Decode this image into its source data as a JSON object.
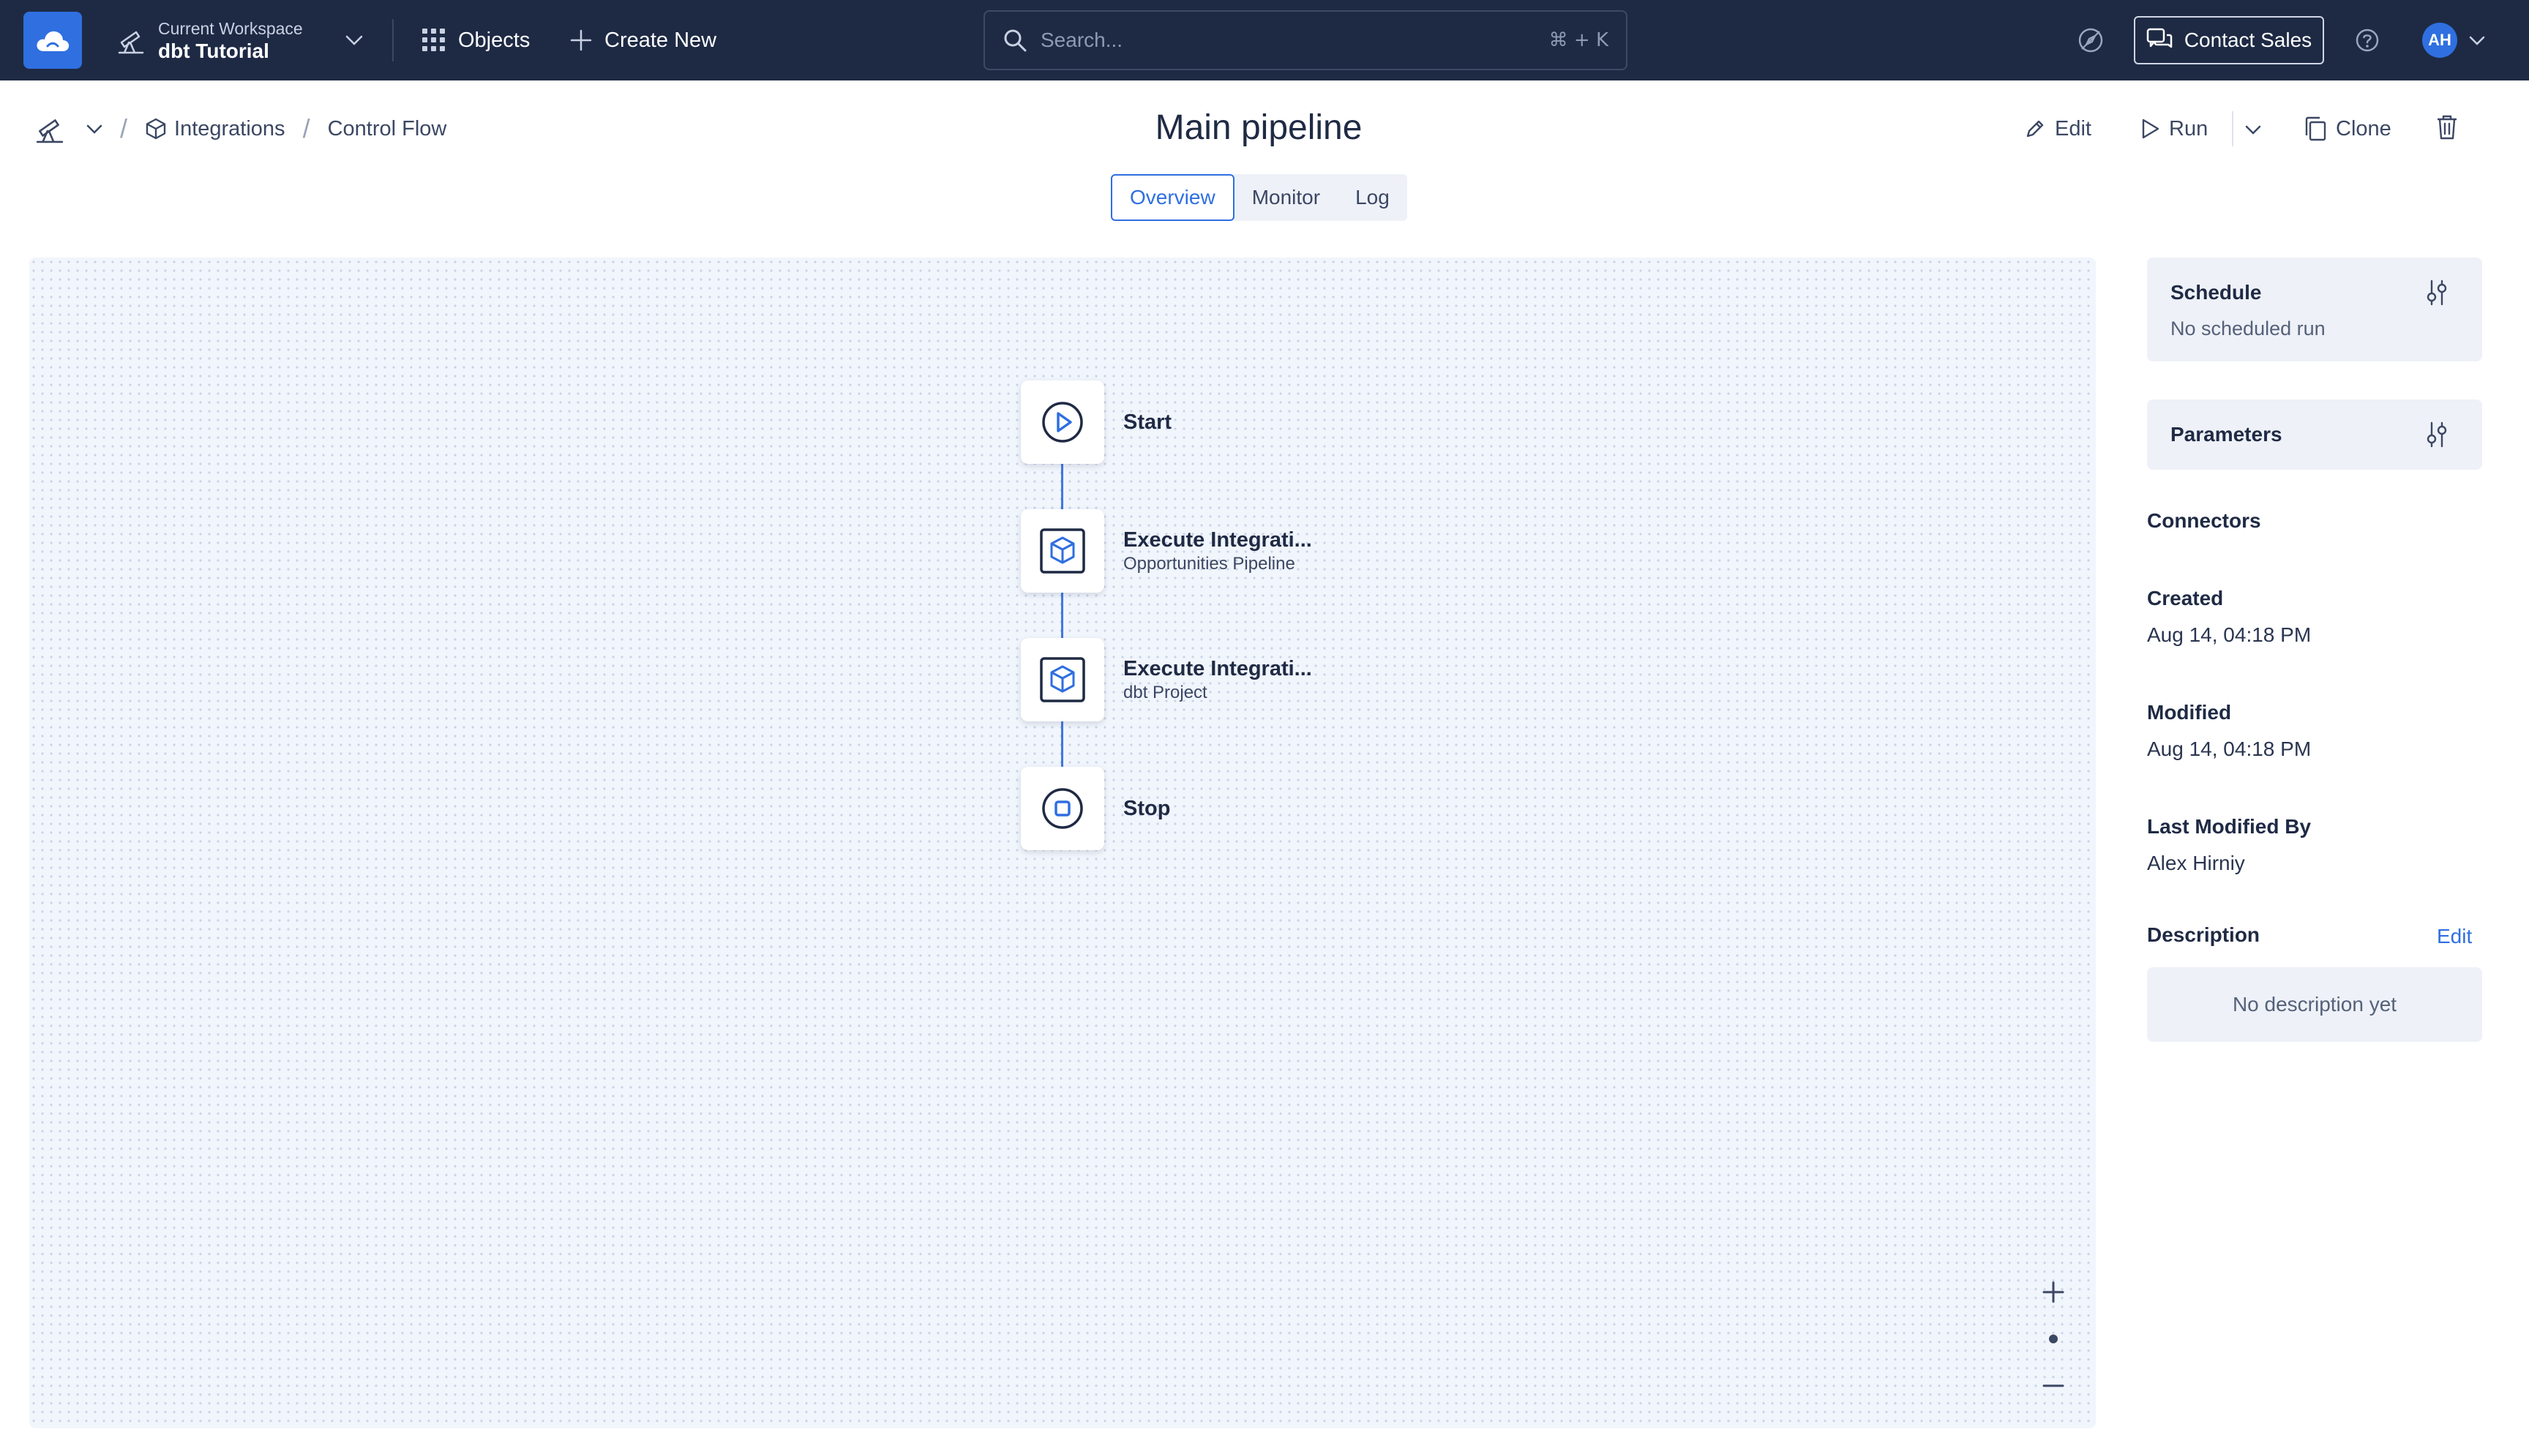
{
  "topbar": {
    "workspace_label": "Current Workspace",
    "workspace_name": "dbt Tutorial",
    "objects_label": "Objects",
    "create_new_label": "Create New",
    "search_placeholder": "Search...",
    "search_shortcut": "⌘ + K",
    "contact_sales_label": "Contact Sales",
    "avatar_initials": "AH"
  },
  "breadcrumb": {
    "integrations": "Integrations",
    "control_flow": "Control Flow"
  },
  "page": {
    "title": "Main pipeline"
  },
  "actions": {
    "edit": "Edit",
    "run": "Run",
    "clone": "Clone"
  },
  "tabs": [
    {
      "label": "Overview",
      "active": true
    },
    {
      "label": "Monitor",
      "active": false
    },
    {
      "label": "Log",
      "active": false
    }
  ],
  "flow": {
    "nodes": [
      {
        "title": "Start",
        "subtitle": "",
        "icon": "play-circle-icon"
      },
      {
        "title": "Execute Integrati...",
        "subtitle": "Opportunities Pipeline",
        "icon": "cube-icon"
      },
      {
        "title": "Execute Integrati...",
        "subtitle": "dbt Project",
        "icon": "cube-icon"
      },
      {
        "title": "Stop",
        "subtitle": "",
        "icon": "stop-circle-icon"
      }
    ]
  },
  "sidebar": {
    "schedule_title": "Schedule",
    "schedule_value": "No scheduled run",
    "parameters_title": "Parameters",
    "connectors_label": "Connectors",
    "created_label": "Created",
    "created_value": "Aug 14, 04:18 PM",
    "modified_label": "Modified",
    "modified_value": "Aug 14, 04:18 PM",
    "last_modified_by_label": "Last Modified By",
    "last_modified_by_value": "Alex Hirniy",
    "description_label": "Description",
    "description_edit": "Edit",
    "description_value": "No description yet"
  },
  "colors": {
    "topbar_bg": "#1e2a44",
    "accent": "#2f6fe0",
    "canvas_bg": "#f1f5fc",
    "card_bg": "#eef1f7"
  }
}
